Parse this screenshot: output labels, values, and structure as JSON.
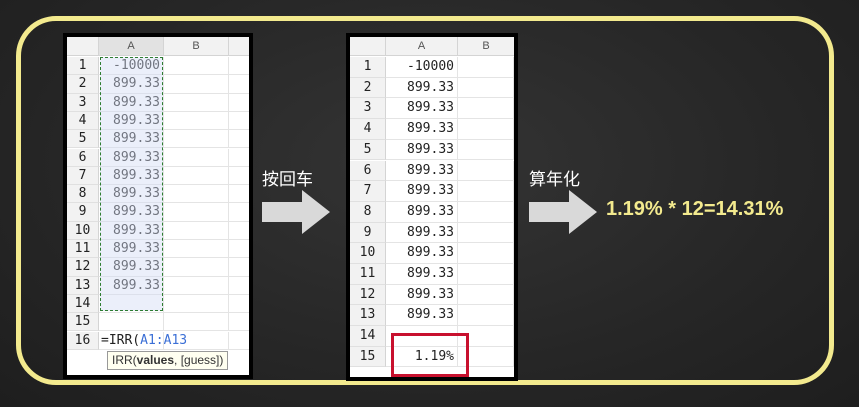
{
  "left_sheet": {
    "col_a": "A",
    "col_b": "B",
    "rows": [
      {
        "num": "1",
        "value": "-10000"
      },
      {
        "num": "2",
        "value": "899.33"
      },
      {
        "num": "3",
        "value": "899.33"
      },
      {
        "num": "4",
        "value": "899.33"
      },
      {
        "num": "5",
        "value": "899.33"
      },
      {
        "num": "6",
        "value": "899.33"
      },
      {
        "num": "7",
        "value": "899.33"
      },
      {
        "num": "8",
        "value": "899.33"
      },
      {
        "num": "9",
        "value": "899.33"
      },
      {
        "num": "10",
        "value": "899.33"
      },
      {
        "num": "11",
        "value": "899.33"
      },
      {
        "num": "12",
        "value": "899.33"
      },
      {
        "num": "13",
        "value": "899.33"
      },
      {
        "num": "14",
        "value": ""
      },
      {
        "num": "15",
        "value": ""
      },
      {
        "num": "16",
        "value": ""
      }
    ],
    "formula_prefix": "=IRR(",
    "formula_range": "A1:A13",
    "tooltip_fn": "IRR(",
    "tooltip_arg1": "values",
    "tooltip_rest": ", [guess])"
  },
  "right_sheet": {
    "col_a": "A",
    "col_b": "B",
    "rows": [
      {
        "num": "1",
        "value": "-10000"
      },
      {
        "num": "2",
        "value": "899.33"
      },
      {
        "num": "3",
        "value": "899.33"
      },
      {
        "num": "4",
        "value": "899.33"
      },
      {
        "num": "5",
        "value": "899.33"
      },
      {
        "num": "6",
        "value": "899.33"
      },
      {
        "num": "7",
        "value": "899.33"
      },
      {
        "num": "8",
        "value": "899.33"
      },
      {
        "num": "9",
        "value": "899.33"
      },
      {
        "num": "10",
        "value": "899.33"
      },
      {
        "num": "11",
        "value": "899.33"
      },
      {
        "num": "12",
        "value": "899.33"
      },
      {
        "num": "13",
        "value": "899.33"
      },
      {
        "num": "14",
        "value": ""
      },
      {
        "num": "15",
        "value": "1.19%"
      }
    ]
  },
  "step1_caption": "按回车",
  "step2_caption": "算年化",
  "result_text": "1.19% * 12=14.31%",
  "colors": {
    "frame": "#f3ea8e",
    "highlight_box": "#c8102e",
    "selection_border": "#2e7d32",
    "formula_ref": "#3b6fd6"
  }
}
